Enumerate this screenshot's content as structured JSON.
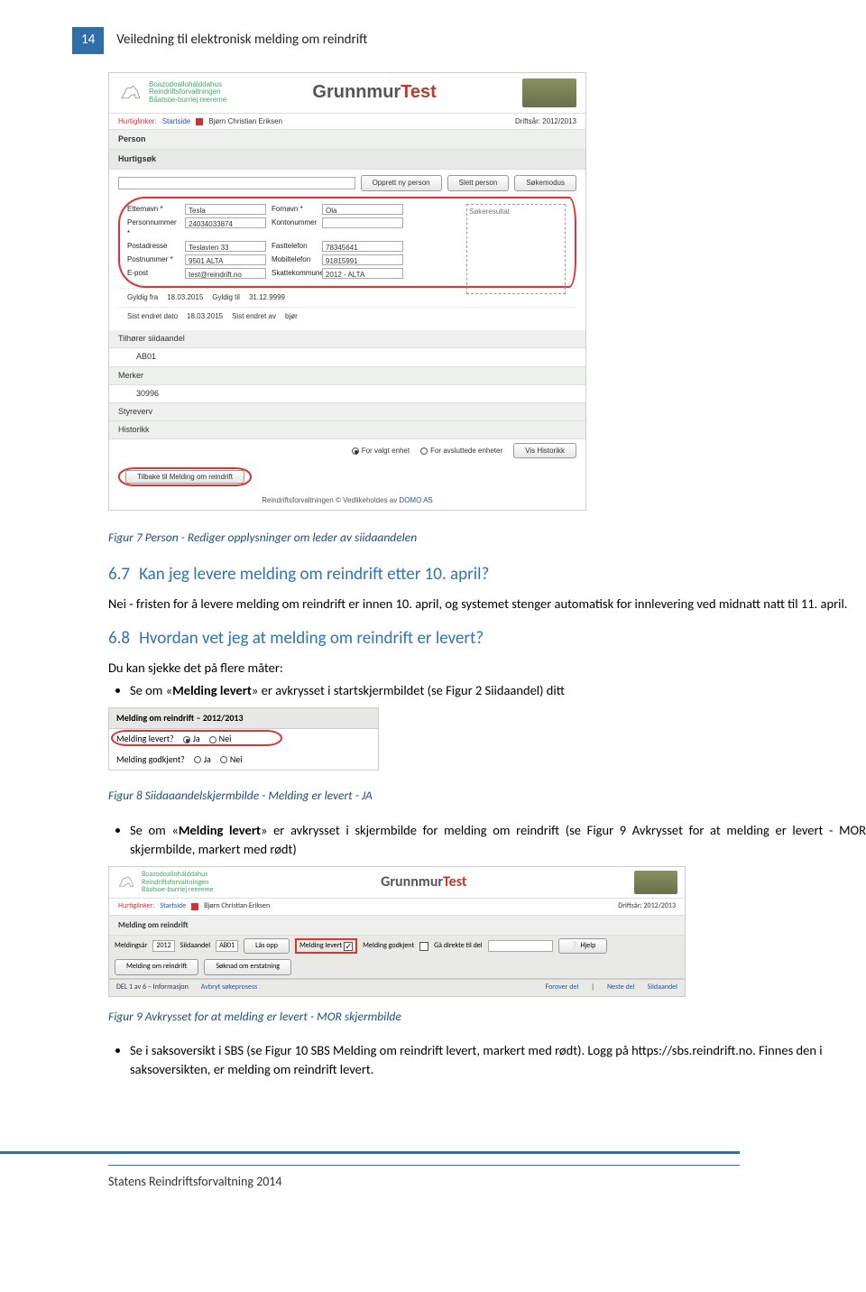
{
  "page": {
    "number": "14",
    "title": "Veiledning til elektronisk melding om reindrift"
  },
  "screenshot1": {
    "logo_lines": [
      "Boazodoallohálddahus",
      "Reindriftsforvaltningen",
      "Båatsoe-burriej reereme"
    ],
    "brand_grey": "Grunnmur",
    "brand_red": "Test",
    "quicklinks_label": "Hurtiglinker:",
    "quicklinks_start": "Startside",
    "user": "Bjørn Christian Eriksen",
    "year_label": "Driftsår: 2012/2013",
    "section_person": "Person",
    "section_search": "Hurtigsøk",
    "btn_opprett": "Opprett ny person",
    "btn_slett": "Slett person",
    "btn_soke": "Søkemodus",
    "resultat": "Søkeresultat",
    "form": {
      "etternavn_l": "Etternavn *",
      "etternavn_v": "Tesla",
      "person_l": "Personnummer *",
      "person_v": "24034033874",
      "post_l": "Postadresse",
      "post_v": "Teslavien 33",
      "postnr_l": "Postnummer *",
      "postnr_v": "9501  ALTA",
      "epost_l": "E-post",
      "epost_v": "test@reindrift.no",
      "gyldigfra_l": "Gyldig fra",
      "gyldigfra_v": "18.03.2015",
      "sistendret_l": "Sist endret dato",
      "sistendret_v": "18.03.2015",
      "fornavn_l": "Fornavn *",
      "fornavn_v": "Ola",
      "konto_l": "Kontonummer",
      "fast_l": "Fasttelefon",
      "fast_v": "78345641",
      "mobil_l": "Mobiltelefon",
      "mobil_v": "91815991",
      "skatte_l": "Skattekommune",
      "skatte_v": "2012 - ALTA",
      "gyldigtil_l": "Gyldig til",
      "gyldigtil_v": "31.12.9999",
      "sistendretav_l": "Sist endret av",
      "sistendretav_v": "bjør"
    },
    "bars": {
      "tilhorer": "Tilhører siidaandel",
      "tilhorer_v": "AB01",
      "merker": "Merker",
      "merker_v": "30996",
      "styre": "Styreverv",
      "historikk": "Historikk"
    },
    "radio_valgt": "For valgt enhet",
    "radio_avslutt": "For avsluttede enheter",
    "btn_vis": "Vis Historikk",
    "btn_tilbake": "Tilbake til Melding om reindrift",
    "foot1": "Reindriftsforvaltningen © Vedlikeholdes av ",
    "foot2": "DOMO AS"
  },
  "caption1": "Figur 7 Person - Rediger opplysninger om leder av siidaandelen",
  "h67_num": "6.7",
  "h67_title": "Kan jeg levere melding om reindrift etter 10. april?",
  "p67": "Nei - fristen for å levere melding om reindrift er innen 10. april, og systemet stenger automatisk for innlevering ved midnatt natt til 11. april.",
  "h68_num": "6.8",
  "h68_title": "Hvordan vet jeg at melding om reindrift er levert?",
  "p68_intro": "Du kan sjekke det på flere måter:",
  "li68_1_a": "Se om «",
  "li68_1_b": "Melding levert",
  "li68_1_c": "» er avkrysset i startskjermbildet (se Figur 2 Siidaandel) ditt",
  "screenshot2": {
    "title": "Melding om reindrift – 2012/2013",
    "row1_label": "Melding levert?",
    "row2_label": "Melding godkjent?",
    "ja": "Ja",
    "nei": "Nei"
  },
  "caption2": "Figur 8 Siidaaandelskjermbilde - Melding er levert - JA",
  "li68_2_a": "Se om «",
  "li68_2_b": "Melding levert",
  "li68_2_c": "» er avkrysset i skjermbilde for melding om reindrift (se Figur 9 Avkrysset for at melding er levert - MOR skjermbilde, markert med rødt)",
  "screenshot3": {
    "section": "Melding om reindrift",
    "year_l": "Meldingsår",
    "year_v": "2012",
    "siida_l": "Siidaandel",
    "siida_v": "AB01",
    "btn_las": "Lås opp",
    "chk_levert": "Melding levert",
    "chk_godkjent": "Melding godkjent",
    "ga_l": "Gå direkte til del",
    "btn_help": "Hjelp",
    "btn_melding": "Melding om reindrift",
    "btn_soknad": "Søknad om erstatning",
    "del_label": "DEL 1 av 6 – Informasjon",
    "avbryt": "Avbryt søkeprosess",
    "forover": "Forover del",
    "neste": "Neste del",
    "siidaandel": "Siidaandel"
  },
  "caption3": "Figur 9 Avkrysset for at melding er levert - MOR skjermbilde",
  "li68_3": "Se i saksoversikt i SBS (se Figur 10 SBS Melding om reindrift levert, markert med rødt). Logg på https://sbs.reindrift.no. Finnes den i saksoversikten, er melding om reindrift levert.",
  "footer": "Statens Reindriftsforvaltning 2014"
}
